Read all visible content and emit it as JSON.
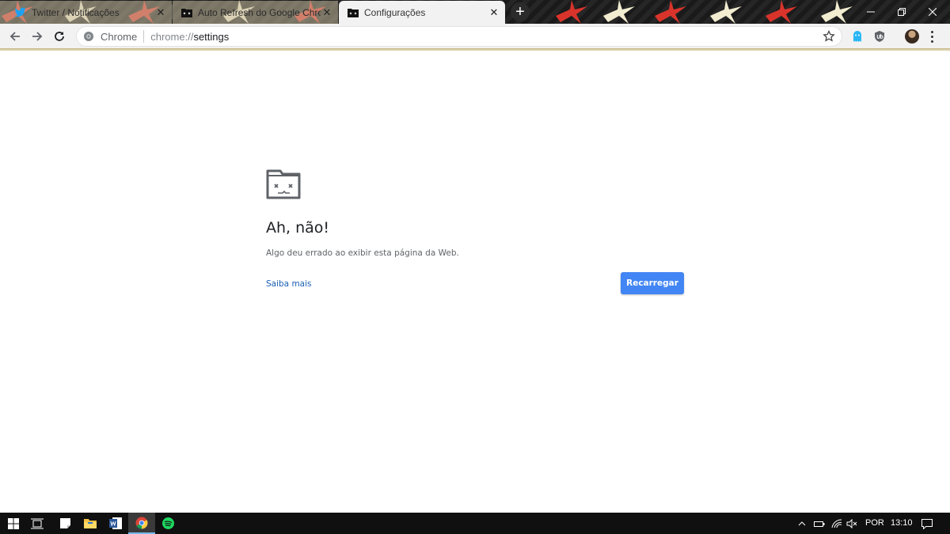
{
  "tabs": [
    {
      "title": "Twitter / Notificações",
      "favicon": "twitter-bird-icon",
      "active": false
    },
    {
      "title": "Auto Refresh do Google Chrome",
      "favicon": "folder-sad-icon",
      "active": false
    },
    {
      "title": "Configurações",
      "favicon": "folder-sad-icon",
      "active": true
    }
  ],
  "omnibox": {
    "chip": "Chrome",
    "url_scheme": "chrome://",
    "url_path": "settings"
  },
  "crash": {
    "icon": "sad-folder-icon",
    "title": "Ah, não!",
    "description": "Algo deu errado ao exibir esta página da Web.",
    "learn_more": "Saiba mais",
    "reload": "Recarregar"
  },
  "taskbar": {
    "apps": [
      "windows-start-icon",
      "task-view-icon",
      "sticky-notes-icon",
      "file-explorer-icon",
      "word-icon",
      "chrome-icon",
      "spotify-icon"
    ],
    "language": "POR",
    "time": "13:10"
  },
  "colors": {
    "accent": "#4285f4",
    "link": "#1a5fb4",
    "taskbar": "#101010"
  }
}
